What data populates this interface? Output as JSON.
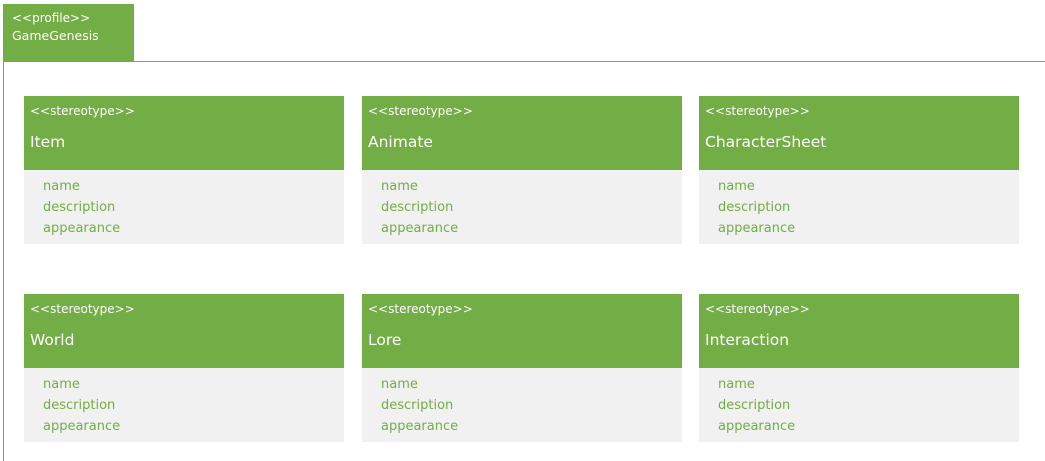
{
  "profile": {
    "keyword": "<<profile>>",
    "name": "GameGenesis"
  },
  "stereotypes": [
    {
      "keyword": "<<stereotype>>",
      "name": "Item",
      "attributes": [
        "name",
        "description",
        "appearance"
      ]
    },
    {
      "keyword": "<<stereotype>>",
      "name": "Animate",
      "attributes": [
        "name",
        "description",
        "appearance"
      ]
    },
    {
      "keyword": "<<stereotype>>",
      "name": "CharacterSheet",
      "attributes": [
        "name",
        "description",
        "appearance"
      ]
    },
    {
      "keyword": "<<stereotype>>",
      "name": "World",
      "attributes": [
        "name",
        "description",
        "appearance"
      ]
    },
    {
      "keyword": "<<stereotype>>",
      "name": "Lore",
      "attributes": [
        "name",
        "description",
        "appearance"
      ]
    },
    {
      "keyword": "<<stereotype>>",
      "name": "Interaction",
      "attributes": [
        "name",
        "description",
        "appearance"
      ]
    }
  ],
  "colors": {
    "accent": "#72ad45",
    "attribute_background": "#f1f1f1",
    "header_text": "#ffffff"
  }
}
